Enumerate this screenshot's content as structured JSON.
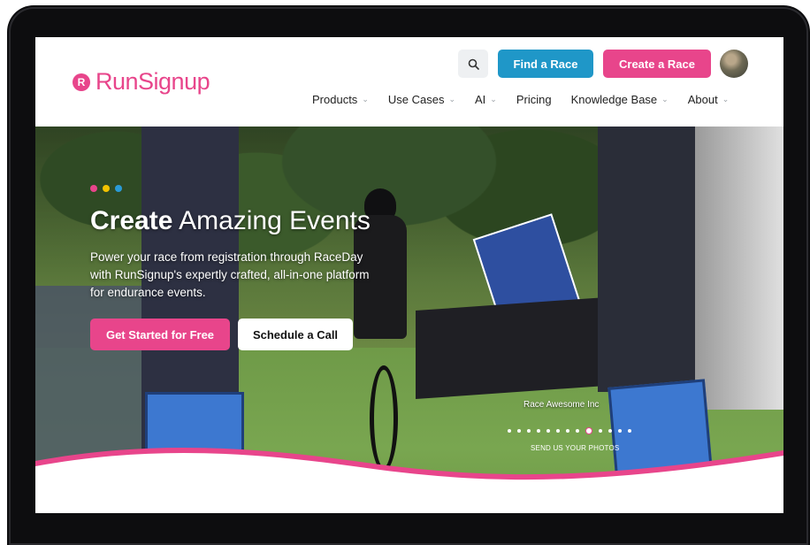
{
  "header": {
    "logo_text": "RunSignup",
    "logo_badge": "R",
    "find_race": "Find a Race",
    "create_race": "Create a Race"
  },
  "nav": [
    {
      "label": "Products",
      "dropdown": true
    },
    {
      "label": "Use Cases",
      "dropdown": true
    },
    {
      "label": "AI",
      "dropdown": true
    },
    {
      "label": "Pricing",
      "dropdown": false
    },
    {
      "label": "Knowledge Base",
      "dropdown": true
    },
    {
      "label": "About",
      "dropdown": true
    }
  ],
  "hero": {
    "title_bold": "Create",
    "title_light": " Amazing Events",
    "subtitle": "Power your race from registration through RaceDay with RunSignup's expertly crafted, all-in-one platform for endurance events.",
    "cta_primary": "Get Started for Free",
    "cta_secondary": "Schedule a Call",
    "photo_credit": "Race Awesome Inc",
    "send_photos": "SEND US YOUR PHOTOS",
    "carousel": {
      "count": 13,
      "active_index": 8
    }
  },
  "colors": {
    "brand_pink": "#e8458b",
    "brand_blue": "#1f97c8",
    "dot_colors": [
      "#e8458b",
      "#f2c200",
      "#2a9ad6"
    ]
  },
  "icons": {
    "search": "search-icon",
    "chevron": "chevron-down-icon"
  }
}
